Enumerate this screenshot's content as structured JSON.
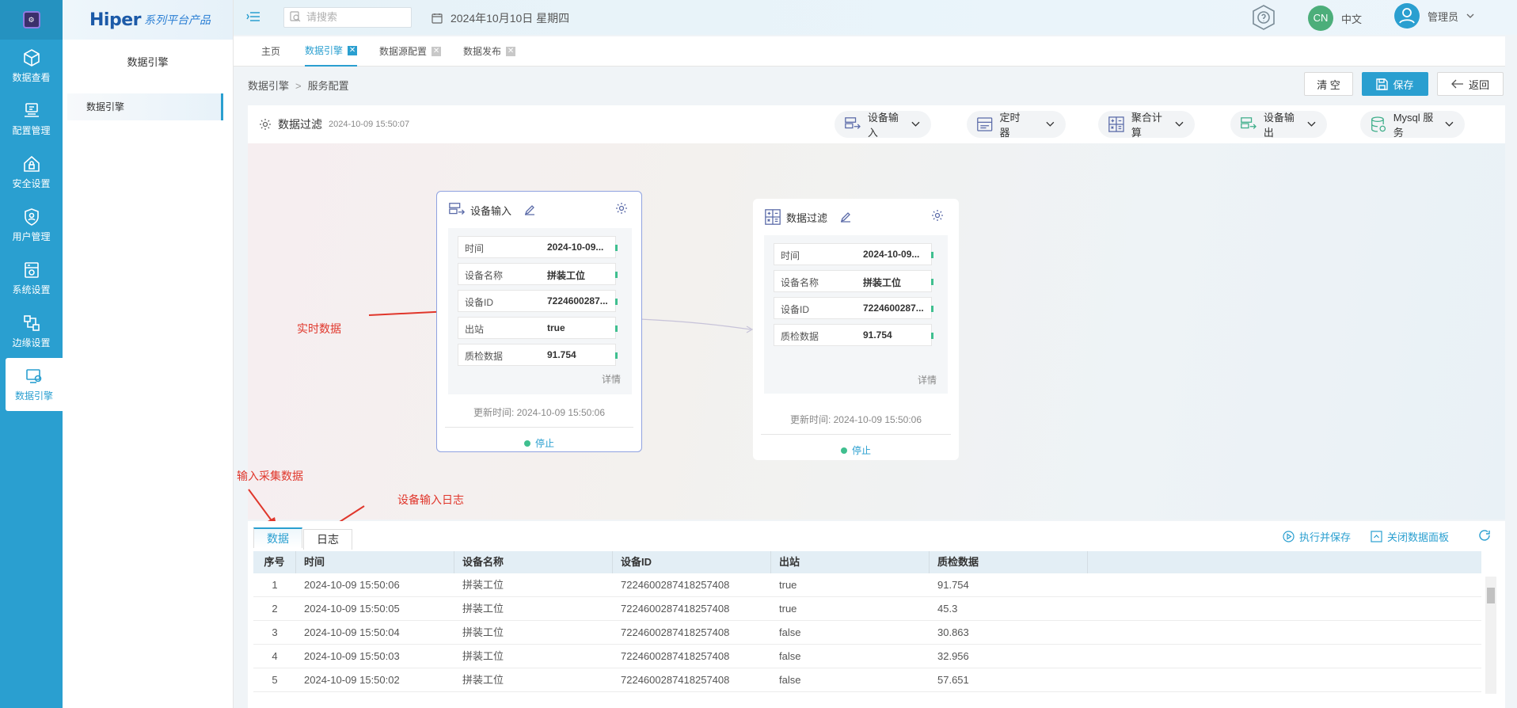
{
  "rail": {
    "items": [
      {
        "label": "数据查看",
        "icon": "cube-icon"
      },
      {
        "label": "配置管理",
        "icon": "config-icon"
      },
      {
        "label": "安全设置",
        "icon": "home-lock-icon"
      },
      {
        "label": "用户管理",
        "icon": "shield-user-icon"
      },
      {
        "label": "系统设置",
        "icon": "server-gear-icon"
      },
      {
        "label": "边缘设置",
        "icon": "network-icon"
      },
      {
        "label": "数据引擎",
        "icon": "engine-icon"
      }
    ],
    "active_index": 6
  },
  "brand": {
    "name": "Hiper",
    "suffix": "系列平台产品"
  },
  "sidebar": {
    "title": "数据引擎",
    "items": [
      {
        "label": "数据引擎"
      }
    ]
  },
  "topbar": {
    "search_placeholder": "请搜索",
    "date": "2024年10月10日 星期四",
    "lang_badge": "CN",
    "lang_label": "中文",
    "user_label": "管理员"
  },
  "tabs": [
    {
      "label": "主页",
      "closable": false,
      "active": false
    },
    {
      "label": "数据引擎",
      "closable": true,
      "active": true
    },
    {
      "label": "数据源配置",
      "closable": true,
      "active": false
    },
    {
      "label": "数据发布",
      "closable": true,
      "active": false
    }
  ],
  "breadcrumb": [
    "数据引擎",
    "服务配置"
  ],
  "actions": {
    "clear": "清 空",
    "save": "保存",
    "back": "返回"
  },
  "flow": {
    "title": "数据过滤",
    "timestamp": "2024-10-09 15:50:07",
    "toolbox": [
      {
        "label": "设备输入",
        "icon": "device-input-icon"
      },
      {
        "label": "定时器",
        "icon": "timer-icon"
      },
      {
        "label": "聚合计算",
        "icon": "calculator-icon"
      },
      {
        "label": "设备输出",
        "icon": "device-output-icon"
      },
      {
        "label": "Mysql 服务",
        "icon": "database-icon"
      }
    ]
  },
  "nodes": [
    {
      "title": "设备输入",
      "fields": [
        {
          "key": "时间",
          "value": "2024-10-09..."
        },
        {
          "key": "设备名称",
          "value": "拼装工位"
        },
        {
          "key": "设备ID",
          "value": "7224600287..."
        },
        {
          "key": "出站",
          "value": "true"
        },
        {
          "key": "质检数据",
          "value": "91.754"
        }
      ],
      "more": "详情",
      "updated": "更新时间: 2024-10-09 15:50:06",
      "status": "停止"
    },
    {
      "title": "数据过滤",
      "fields": [
        {
          "key": "时间",
          "value": "2024-10-09..."
        },
        {
          "key": "设备名称",
          "value": "拼装工位"
        },
        {
          "key": "设备ID",
          "value": "7224600287..."
        },
        {
          "key": "质检数据",
          "value": "91.754"
        }
      ],
      "more": "详情",
      "updated": "更新时间: 2024-10-09 15:50:06",
      "status": "停止"
    }
  ],
  "annotations": {
    "realtime": "实时数据",
    "input_data": "输入采集数据",
    "input_log": "设备输入日志"
  },
  "panel": {
    "tabs": [
      "数据",
      "日志"
    ],
    "actions": {
      "run_save": "执行并保存",
      "close_panel": "关闭数据面板"
    },
    "columns": [
      "序号",
      "时间",
      "设备名称",
      "设备ID",
      "出站",
      "质检数据"
    ],
    "rows": [
      [
        "1",
        "2024-10-09 15:50:06",
        "拼装工位",
        "7224600287418257408",
        "true",
        "91.754"
      ],
      [
        "2",
        "2024-10-09 15:50:05",
        "拼装工位",
        "7224600287418257408",
        "true",
        "45.3"
      ],
      [
        "3",
        "2024-10-09 15:50:04",
        "拼装工位",
        "7224600287418257408",
        "false",
        "30.863"
      ],
      [
        "4",
        "2024-10-09 15:50:03",
        "拼装工位",
        "7224600287418257408",
        "false",
        "32.956"
      ],
      [
        "5",
        "2024-10-09 15:50:02",
        "拼装工位",
        "7224600287418257408",
        "false",
        "57.651"
      ]
    ]
  },
  "colors": {
    "primary": "#2a9fd0",
    "annotation": "#e0362b",
    "status_dot": "#3fbf8f"
  }
}
